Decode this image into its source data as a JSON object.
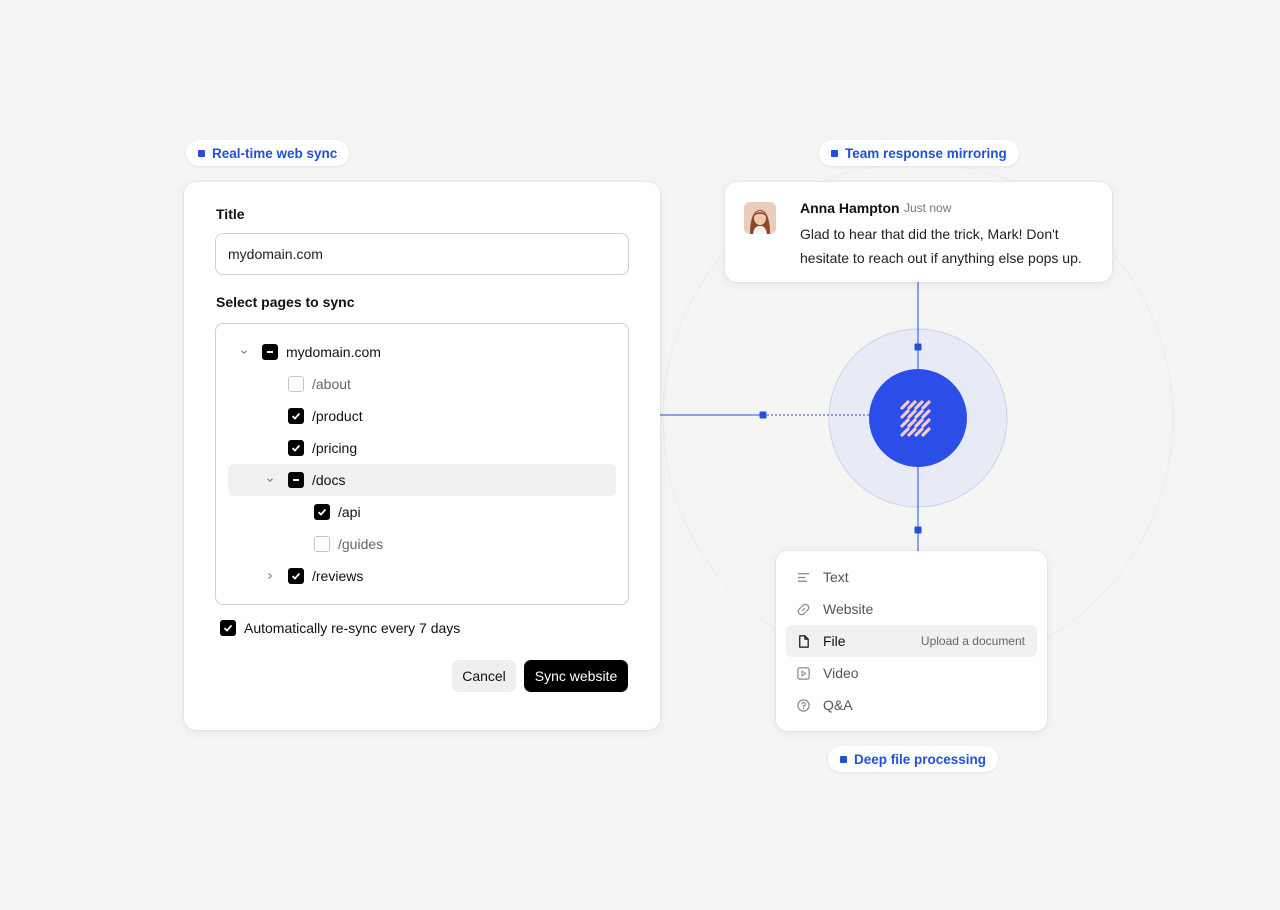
{
  "badges": {
    "web_sync": "Real-time web sync",
    "team_mirror": "Team response mirroring",
    "file_processing": "Deep file processing"
  },
  "sync_form": {
    "title_label": "Title",
    "title_value": "mydomain.com",
    "pages_label": "Select pages to sync",
    "tree": [
      {
        "label": "mydomain.com",
        "state": "partial",
        "expander": "expanded"
      },
      {
        "label": "/about",
        "state": "unchecked"
      },
      {
        "label": "/product",
        "state": "checked"
      },
      {
        "label": "/pricing",
        "state": "checked"
      },
      {
        "label": "/docs",
        "state": "partial",
        "expander": "expanded"
      },
      {
        "label": "/api",
        "state": "checked"
      },
      {
        "label": "/guides",
        "state": "unchecked"
      },
      {
        "label": "/reviews",
        "state": "checked",
        "expander": "collapsed"
      }
    ],
    "resync_label": "Automatically re-sync every 7 days",
    "resync_checked": true,
    "cancel_label": "Cancel",
    "submit_label": "Sync website"
  },
  "message": {
    "author": "Anna Hampton",
    "time": "Just now",
    "text": "Glad to hear that did the trick, Mark! Don't hesitate to reach out if anything else pops up."
  },
  "sources": [
    {
      "label": "Text",
      "icon": "text-lines-icon"
    },
    {
      "label": "Website",
      "icon": "link-icon"
    },
    {
      "label": "File",
      "icon": "file-icon",
      "hint": "Upload a document",
      "highlighted": true
    },
    {
      "label": "Video",
      "icon": "play-square-icon"
    },
    {
      "label": "Q&A",
      "icon": "question-circle-icon"
    }
  ],
  "colors": {
    "accent": "#2350d8",
    "hub": "#2b4de8",
    "background": "#f5f5f3"
  }
}
